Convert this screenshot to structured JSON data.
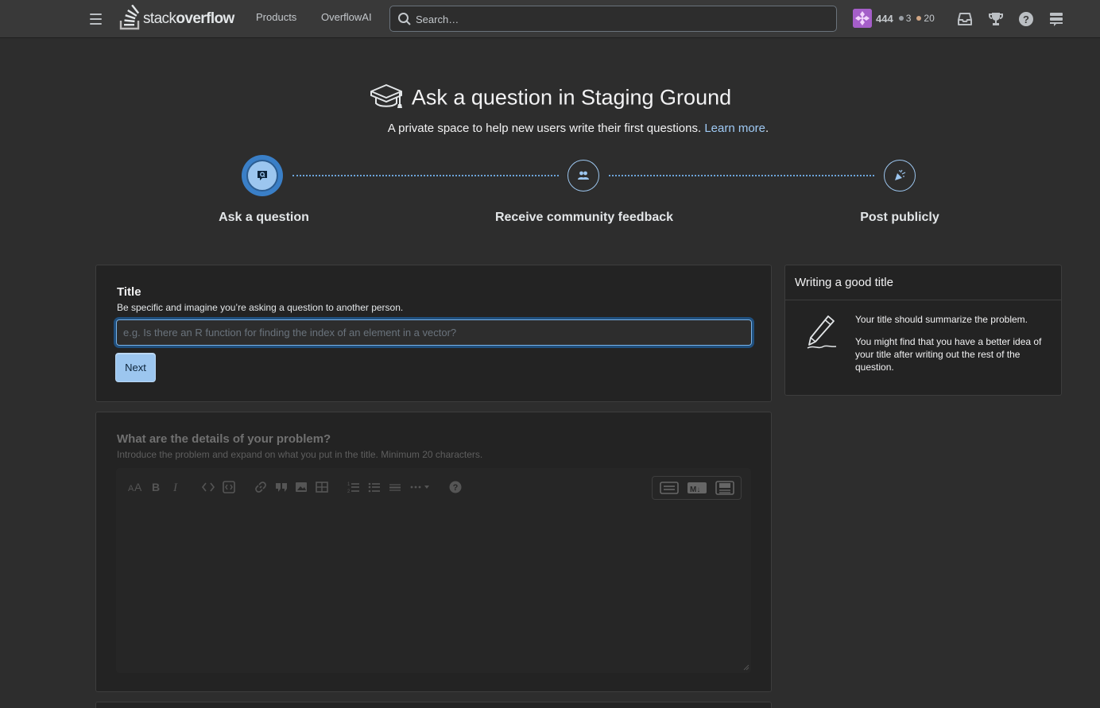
{
  "topbar": {
    "logo_text_light": "stack",
    "logo_text_bold": "overflow",
    "nav": [
      "Products",
      "OverflowAI"
    ],
    "search_placeholder": "Search…",
    "reputation": "444",
    "silver_badges": "3",
    "bronze_badges": "20",
    "badge_colors": {
      "silver": "#9a9fa5",
      "bronze": "#d1a684"
    },
    "icons": [
      "inbox-icon",
      "achievements-icon",
      "help-icon",
      "site-switcher-icon"
    ]
  },
  "hero": {
    "title": "Ask a question in Staging Ground",
    "subtitle": "A private space to help new users write their first questions.",
    "learn_more": "Learn more",
    "period": "."
  },
  "steps": [
    {
      "label": "Ask a question",
      "icon": "question-bubble-icon",
      "active": true
    },
    {
      "label": "Receive community feedback",
      "icon": "community-icon",
      "active": false
    },
    {
      "label": "Post publicly",
      "icon": "party-popper-icon",
      "active": false
    }
  ],
  "title_section": {
    "heading": "Title",
    "description": "Be specific and imagine you’re asking a question to another person.",
    "placeholder": "e.g. Is there an R function for finding the index of an element in a vector?",
    "next_label": "Next"
  },
  "sidebar": {
    "heading": "Writing a good title",
    "paragraph1": "Your title should summarize the problem.",
    "paragraph2": "You might find that you have a better idea of your title after writing out the rest of the question."
  },
  "details_section": {
    "heading": "What are the details of your problem?",
    "description": "Introduce the problem and expand on what you put in the title. Minimum 20 characters.",
    "toolbar": [
      "text-size-icon",
      "bold-icon",
      "italic-icon",
      "code-icon",
      "code-block-icon",
      "link-icon",
      "blockquote-icon",
      "image-icon",
      "table-icon",
      "ordered-list-icon",
      "unordered-list-icon",
      "horizontal-rule-icon",
      "more-icon",
      "help-icon"
    ],
    "modes": [
      "rich-text-mode-icon",
      "markdown-mode-icon",
      "markdown-preview-mode-icon"
    ]
  },
  "colors": {
    "accent": "#9cc6ef",
    "link": "#9fcaf5",
    "background": "#2d2d2d",
    "topbar": "#393939"
  }
}
